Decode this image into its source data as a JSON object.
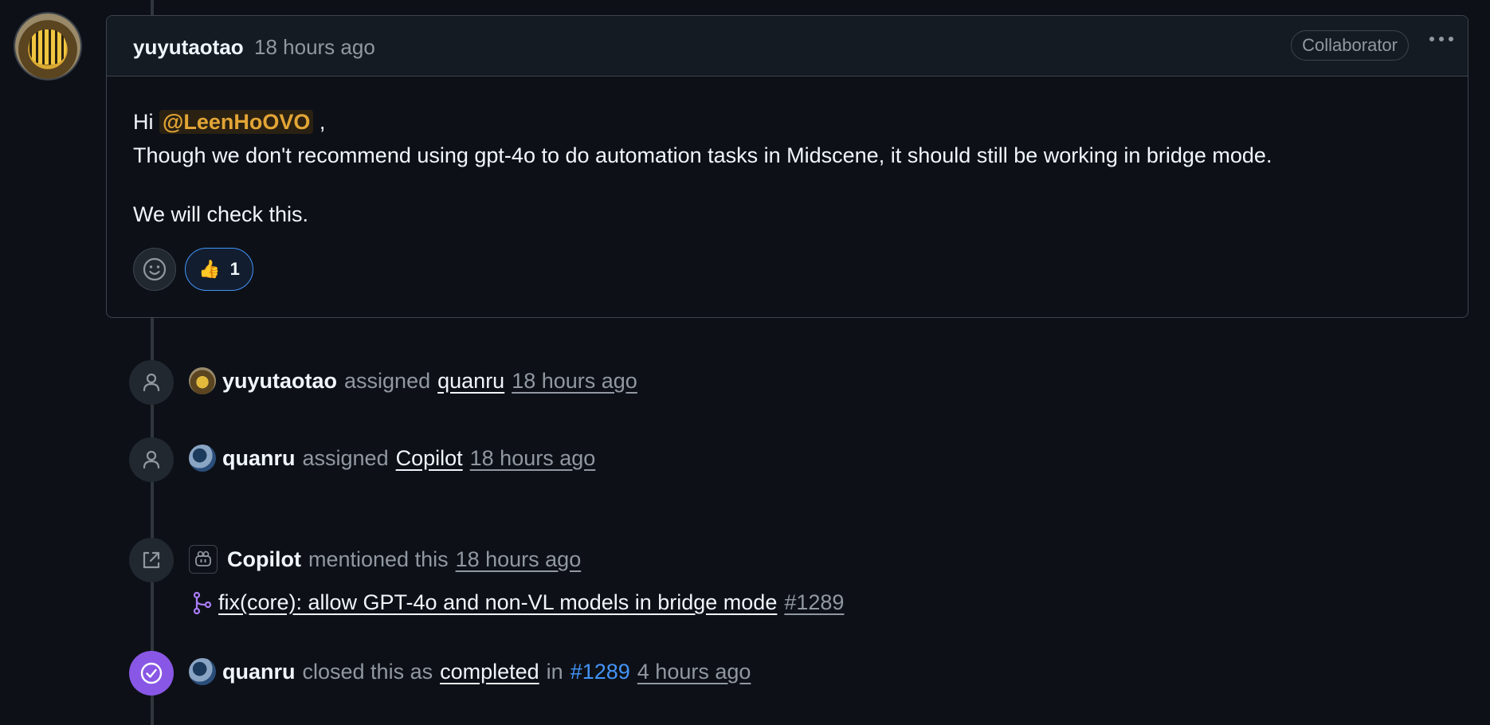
{
  "comment": {
    "author": "yuyutaotao",
    "time": "18 hours ago",
    "badge": "Collaborator",
    "greeting": "Hi",
    "mention": "@LeenHoOVO",
    "greeting_suffix": ",",
    "line1": "Though we don't recommend using gpt-4o to do automation tasks in Midscene, it should still be working in bridge mode.",
    "line2": "We will check this.",
    "reaction_emoji": "👍",
    "reaction_count": "1"
  },
  "events": [
    {
      "actor": "yuyutaotao",
      "action": "assigned",
      "target": "quanru",
      "time": "18 hours ago"
    },
    {
      "actor": "quanru",
      "action": "assigned",
      "target": "Copilot",
      "time": "18 hours ago"
    },
    {
      "actor": "Copilot",
      "action": "mentioned this",
      "time": "18 hours ago",
      "pr_title": "fix(core): allow GPT-4o and non-VL models in bridge mode",
      "pr_number": "#1289"
    },
    {
      "actor": "quanru",
      "action": "closed this as",
      "target": "completed",
      "in_word": "in",
      "ref": "#1289",
      "time": "4 hours ago"
    }
  ]
}
